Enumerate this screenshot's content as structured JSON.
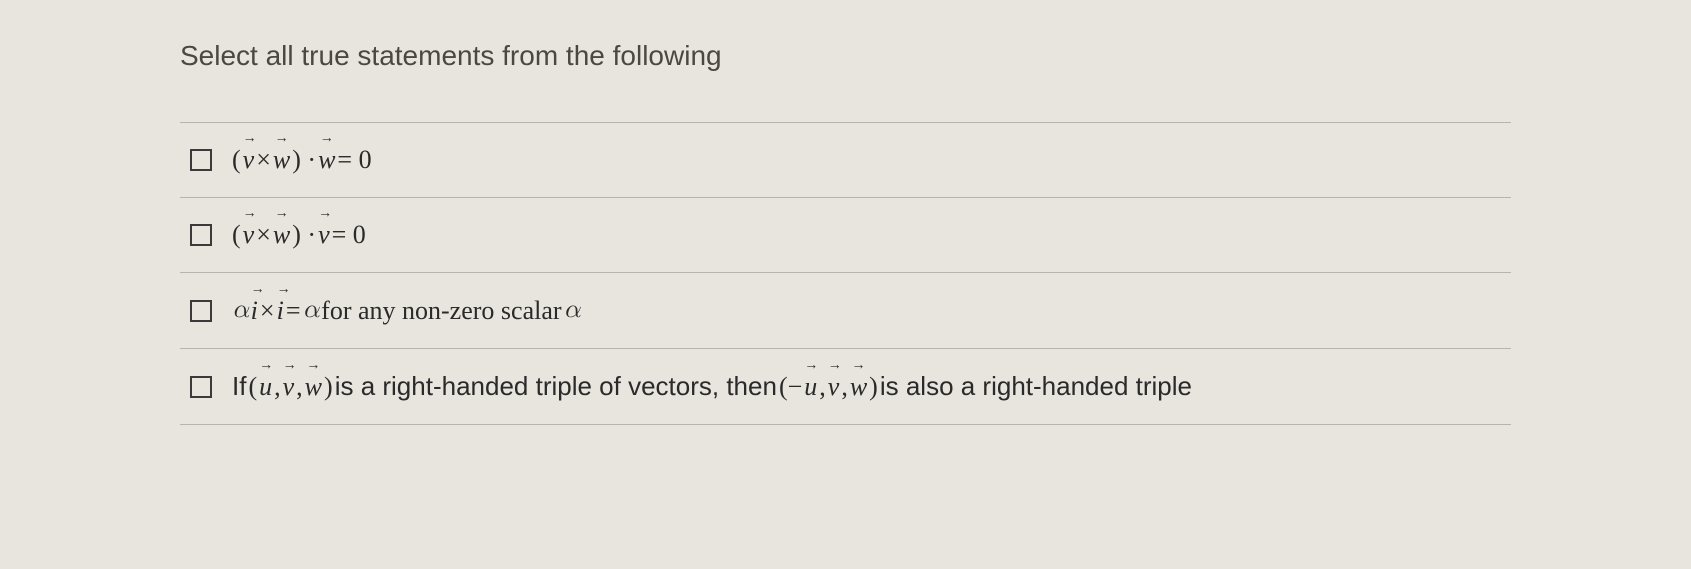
{
  "prompt": "Select all true statements from the following",
  "options": [
    {
      "html": "(<span class='vec'>v</span> × <span class='vec'>w</span>) · <span class='vec'>w</span> = 0",
      "plain": "(v × w) · w = 0"
    },
    {
      "html": "(<span class='vec'>v</span> × <span class='vec'>w</span>) · <span class='vec'>v</span> = 0",
      "plain": "(v × w) · v = 0"
    },
    {
      "html": "<span class='math'>α</span><span class='vec'>i</span> × <span class='vec'>i</span> = <span class='math'>α</span> <span class='upright'>for any non-zero scalar</span> <span class='math'>α</span>",
      "plain": "αi × i = α for any non-zero scalar α"
    },
    {
      "html": "<span class='sans'>If </span>(<span class='vec'>u</span>, <span class='vec'>v</span>, <span class='vec'>w</span>)<span class='sans'> is a right-handed triple of vectors, then </span>(−<span class='vec'>u</span>, <span class='vec'>v</span>, <span class='vec'>w</span>)<span class='sans'> is also a right-handed triple</span>",
      "plain": "If (u, v, w) is a right-handed triple of vectors, then (−u, v, w) is also a right-handed triple"
    }
  ]
}
